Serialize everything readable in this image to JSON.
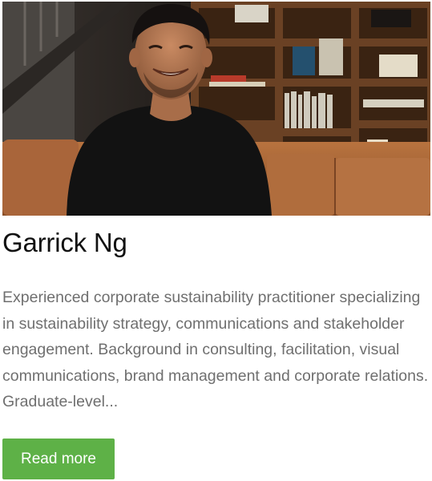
{
  "profile": {
    "photo_alt": "Garrick Ng",
    "name": "Garrick Ng",
    "bio": "Experienced corporate sustainability practitioner specializing in sustainability strategy, communications and stakeholder engagement. Background in consulting, facilitation, visual communications, brand management and corporate relations. Graduate-level...",
    "read_more_label": "Read more"
  },
  "colors": {
    "button_background": "#5eb147",
    "button_text": "#ffffff",
    "name_text": "#111111",
    "bio_text": "#6f6f6f"
  }
}
